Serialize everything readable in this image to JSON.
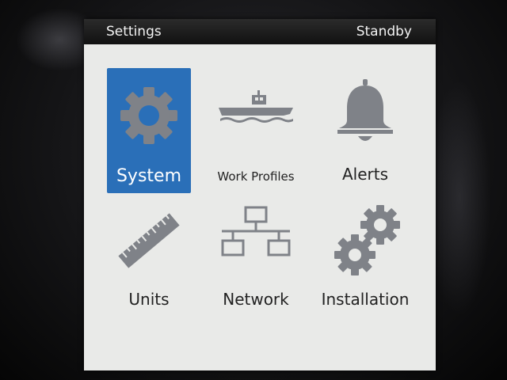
{
  "titlebar": {
    "title": "Settings",
    "status": "Standby"
  },
  "tiles": [
    {
      "label": "System",
      "icon": "gear-icon",
      "selected": true
    },
    {
      "label": "Work Profiles",
      "icon": "boat-icon",
      "selected": false
    },
    {
      "label": "Alerts",
      "icon": "bell-icon",
      "selected": false
    },
    {
      "label": "Units",
      "icon": "ruler-icon",
      "selected": false
    },
    {
      "label": "Network",
      "icon": "network-icon",
      "selected": false
    },
    {
      "label": "Installation",
      "icon": "gears-icon",
      "selected": false
    }
  ],
  "colors": {
    "selected_tile": "#2a6fb8",
    "screen_bg": "#e9eae8",
    "icon_gray": "#7f8288",
    "titlebar_bg": "#1a1a1a"
  }
}
